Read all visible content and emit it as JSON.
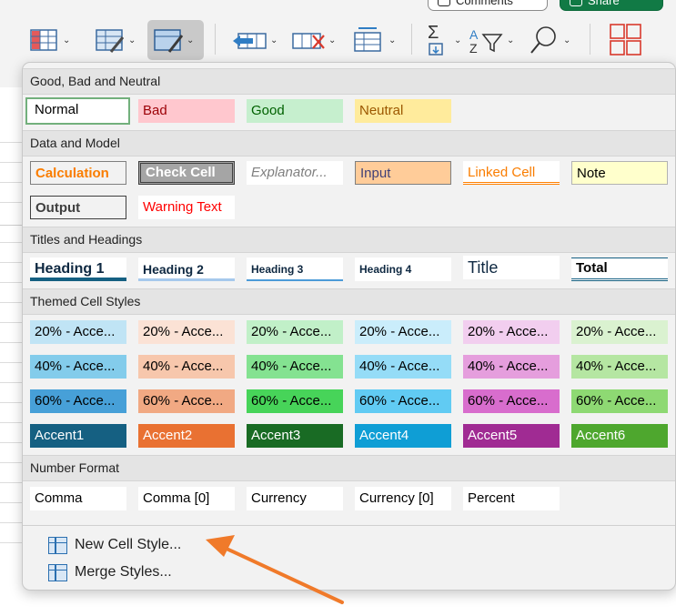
{
  "toolbar": {
    "comments_label": "Comments",
    "share_label": "Share",
    "tools": [
      {
        "name": "conditional-formatting-icon"
      },
      {
        "name": "format-as-table-icon"
      },
      {
        "name": "cell-styles-icon"
      },
      {
        "name": "insert-cells-icon"
      },
      {
        "name": "delete-cells-icon"
      },
      {
        "name": "format-cells-icon"
      },
      {
        "name": "autosum-icon"
      },
      {
        "name": "sort-filter-icon"
      },
      {
        "name": "find-select-icon"
      },
      {
        "name": "add-ins-icon"
      }
    ]
  },
  "sections": {
    "good_bad_neutral": "Good, Bad and Neutral",
    "data_model": "Data and Model",
    "titles": "Titles and Headings",
    "themed": "Themed Cell Styles",
    "number_format": "Number Format"
  },
  "styles": {
    "normal": "Normal",
    "bad": "Bad",
    "good": "Good",
    "neutral": "Neutral",
    "calculation": "Calculation",
    "check_cell": "Check Cell",
    "explanatory": "Explanator...",
    "input": "Input",
    "linked_cell": "Linked Cell",
    "note": "Note",
    "output": "Output",
    "warning_text": "Warning Text",
    "heading1": "Heading 1",
    "heading2": "Heading 2",
    "heading3": "Heading 3",
    "heading4": "Heading 4",
    "title": "Title",
    "total": "Total",
    "accent20": [
      "20% - Acce...",
      "20% - Acce...",
      "20% - Acce...",
      "20% - Acce...",
      "20% - Acce...",
      "20% - Acce..."
    ],
    "accent40": [
      "40% - Acce...",
      "40% - Acce...",
      "40% - Acce...",
      "40% - Acce...",
      "40% - Acce...",
      "40% - Acce..."
    ],
    "accent60": [
      "60% - Acce...",
      "60% - Acce...",
      "60% - Acce...",
      "60% - Acce...",
      "60% - Acce...",
      "60% - Acce..."
    ],
    "accent": [
      "Accent1",
      "Accent2",
      "Accent3",
      "Accent4",
      "Accent5",
      "Accent6"
    ],
    "comma": "Comma",
    "comma0": "Comma [0]",
    "currency": "Currency",
    "currency0": "Currency [0]",
    "percent": "Percent"
  },
  "menu": {
    "new_cell_style": "New Cell Style...",
    "merge_styles": "Merge Styles..."
  },
  "colors": {
    "accent1": "#156082",
    "accent2": "#e97132",
    "accent3": "#196b24",
    "accent4": "#0f9ed5",
    "accent5": "#a02b93",
    "accent6": "#4ea72e",
    "annotation_arrow": "#f07a2a"
  }
}
